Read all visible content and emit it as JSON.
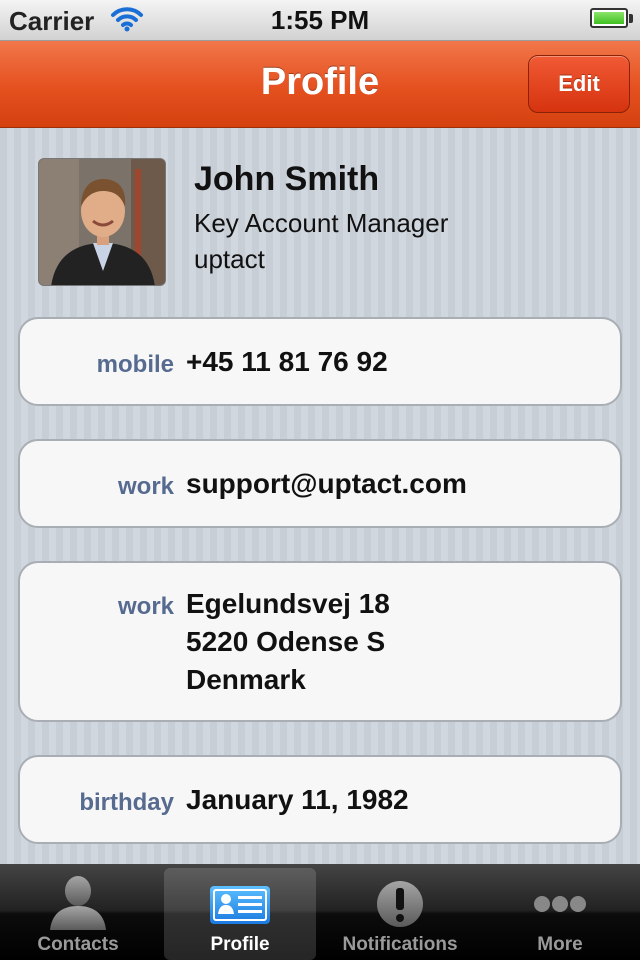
{
  "status": {
    "carrier": "Carrier",
    "time": "1:55 PM",
    "battery_level": 1.0,
    "icons": [
      "wifi-icon",
      "battery-icon"
    ]
  },
  "nav": {
    "title": "Profile",
    "edit_label": "Edit"
  },
  "profile": {
    "name": "John Smith",
    "job_title": "Key Account Manager",
    "company": "uptact"
  },
  "fields": [
    {
      "label": "mobile",
      "lines": [
        "+45 11 81 76 92"
      ]
    },
    {
      "label": "work",
      "lines": [
        "support@uptact.com"
      ]
    },
    {
      "label": "work",
      "lines": [
        "Egelundsvej 18",
        "5220 Odense S",
        "Denmark"
      ]
    },
    {
      "label": "birthday",
      "lines": [
        "January 11, 1982"
      ]
    }
  ],
  "tabs": [
    {
      "label": "Contacts",
      "icon": "contacts-icon",
      "active": false
    },
    {
      "label": "Profile",
      "icon": "profile-card-icon",
      "active": true
    },
    {
      "label": "Notifications",
      "icon": "notifications-icon",
      "active": false
    },
    {
      "label": "More",
      "icon": "more-icon",
      "active": false
    }
  ],
  "colors": {
    "navbar_accent": "#e5501f",
    "label_color": "#566b8f",
    "background": "#cdd3da"
  }
}
